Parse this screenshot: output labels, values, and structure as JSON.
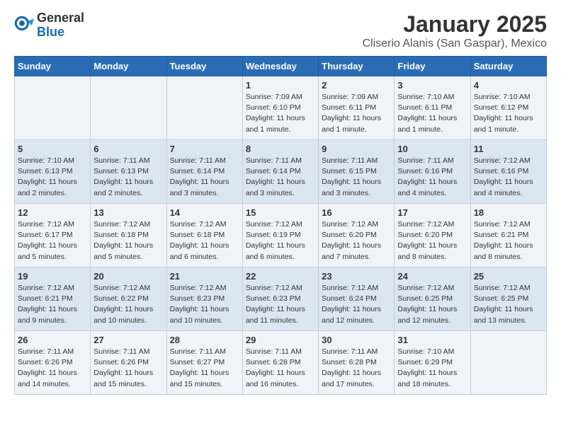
{
  "header": {
    "logo_general": "General",
    "logo_blue": "Blue",
    "title": "January 2025",
    "subtitle": "Cliserio Alanis (San Gaspar), Mexico"
  },
  "days_of_week": [
    "Sunday",
    "Monday",
    "Tuesday",
    "Wednesday",
    "Thursday",
    "Friday",
    "Saturday"
  ],
  "weeks": [
    [
      {
        "day": "",
        "sunrise": "",
        "sunset": "",
        "daylight": ""
      },
      {
        "day": "",
        "sunrise": "",
        "sunset": "",
        "daylight": ""
      },
      {
        "day": "",
        "sunrise": "",
        "sunset": "",
        "daylight": ""
      },
      {
        "day": "1",
        "sunrise": "Sunrise: 7:09 AM",
        "sunset": "Sunset: 6:10 PM",
        "daylight": "Daylight: 11 hours and 1 minute."
      },
      {
        "day": "2",
        "sunrise": "Sunrise: 7:09 AM",
        "sunset": "Sunset: 6:11 PM",
        "daylight": "Daylight: 11 hours and 1 minute."
      },
      {
        "day": "3",
        "sunrise": "Sunrise: 7:10 AM",
        "sunset": "Sunset: 6:11 PM",
        "daylight": "Daylight: 11 hours and 1 minute."
      },
      {
        "day": "4",
        "sunrise": "Sunrise: 7:10 AM",
        "sunset": "Sunset: 6:12 PM",
        "daylight": "Daylight: 11 hours and 1 minute."
      }
    ],
    [
      {
        "day": "5",
        "sunrise": "Sunrise: 7:10 AM",
        "sunset": "Sunset: 6:13 PM",
        "daylight": "Daylight: 11 hours and 2 minutes."
      },
      {
        "day": "6",
        "sunrise": "Sunrise: 7:11 AM",
        "sunset": "Sunset: 6:13 PM",
        "daylight": "Daylight: 11 hours and 2 minutes."
      },
      {
        "day": "7",
        "sunrise": "Sunrise: 7:11 AM",
        "sunset": "Sunset: 6:14 PM",
        "daylight": "Daylight: 11 hours and 3 minutes."
      },
      {
        "day": "8",
        "sunrise": "Sunrise: 7:11 AM",
        "sunset": "Sunset: 6:14 PM",
        "daylight": "Daylight: 11 hours and 3 minutes."
      },
      {
        "day": "9",
        "sunrise": "Sunrise: 7:11 AM",
        "sunset": "Sunset: 6:15 PM",
        "daylight": "Daylight: 11 hours and 3 minutes."
      },
      {
        "day": "10",
        "sunrise": "Sunrise: 7:11 AM",
        "sunset": "Sunset: 6:16 PM",
        "daylight": "Daylight: 11 hours and 4 minutes."
      },
      {
        "day": "11",
        "sunrise": "Sunrise: 7:12 AM",
        "sunset": "Sunset: 6:16 PM",
        "daylight": "Daylight: 11 hours and 4 minutes."
      }
    ],
    [
      {
        "day": "12",
        "sunrise": "Sunrise: 7:12 AM",
        "sunset": "Sunset: 6:17 PM",
        "daylight": "Daylight: 11 hours and 5 minutes."
      },
      {
        "day": "13",
        "sunrise": "Sunrise: 7:12 AM",
        "sunset": "Sunset: 6:18 PM",
        "daylight": "Daylight: 11 hours and 5 minutes."
      },
      {
        "day": "14",
        "sunrise": "Sunrise: 7:12 AM",
        "sunset": "Sunset: 6:18 PM",
        "daylight": "Daylight: 11 hours and 6 minutes."
      },
      {
        "day": "15",
        "sunrise": "Sunrise: 7:12 AM",
        "sunset": "Sunset: 6:19 PM",
        "daylight": "Daylight: 11 hours and 6 minutes."
      },
      {
        "day": "16",
        "sunrise": "Sunrise: 7:12 AM",
        "sunset": "Sunset: 6:20 PM",
        "daylight": "Daylight: 11 hours and 7 minutes."
      },
      {
        "day": "17",
        "sunrise": "Sunrise: 7:12 AM",
        "sunset": "Sunset: 6:20 PM",
        "daylight": "Daylight: 11 hours and 8 minutes."
      },
      {
        "day": "18",
        "sunrise": "Sunrise: 7:12 AM",
        "sunset": "Sunset: 6:21 PM",
        "daylight": "Daylight: 11 hours and 8 minutes."
      }
    ],
    [
      {
        "day": "19",
        "sunrise": "Sunrise: 7:12 AM",
        "sunset": "Sunset: 6:21 PM",
        "daylight": "Daylight: 11 hours and 9 minutes."
      },
      {
        "day": "20",
        "sunrise": "Sunrise: 7:12 AM",
        "sunset": "Sunset: 6:22 PM",
        "daylight": "Daylight: 11 hours and 10 minutes."
      },
      {
        "day": "21",
        "sunrise": "Sunrise: 7:12 AM",
        "sunset": "Sunset: 6:23 PM",
        "daylight": "Daylight: 11 hours and 10 minutes."
      },
      {
        "day": "22",
        "sunrise": "Sunrise: 7:12 AM",
        "sunset": "Sunset: 6:23 PM",
        "daylight": "Daylight: 11 hours and 11 minutes."
      },
      {
        "day": "23",
        "sunrise": "Sunrise: 7:12 AM",
        "sunset": "Sunset: 6:24 PM",
        "daylight": "Daylight: 11 hours and 12 minutes."
      },
      {
        "day": "24",
        "sunrise": "Sunrise: 7:12 AM",
        "sunset": "Sunset: 6:25 PM",
        "daylight": "Daylight: 11 hours and 12 minutes."
      },
      {
        "day": "25",
        "sunrise": "Sunrise: 7:12 AM",
        "sunset": "Sunset: 6:25 PM",
        "daylight": "Daylight: 11 hours and 13 minutes."
      }
    ],
    [
      {
        "day": "26",
        "sunrise": "Sunrise: 7:11 AM",
        "sunset": "Sunset: 6:26 PM",
        "daylight": "Daylight: 11 hours and 14 minutes."
      },
      {
        "day": "27",
        "sunrise": "Sunrise: 7:11 AM",
        "sunset": "Sunset: 6:26 PM",
        "daylight": "Daylight: 11 hours and 15 minutes."
      },
      {
        "day": "28",
        "sunrise": "Sunrise: 7:11 AM",
        "sunset": "Sunset: 6:27 PM",
        "daylight": "Daylight: 11 hours and 15 minutes."
      },
      {
        "day": "29",
        "sunrise": "Sunrise: 7:11 AM",
        "sunset": "Sunset: 6:28 PM",
        "daylight": "Daylight: 11 hours and 16 minutes."
      },
      {
        "day": "30",
        "sunrise": "Sunrise: 7:11 AM",
        "sunset": "Sunset: 6:28 PM",
        "daylight": "Daylight: 11 hours and 17 minutes."
      },
      {
        "day": "31",
        "sunrise": "Sunrise: 7:10 AM",
        "sunset": "Sunset: 6:29 PM",
        "daylight": "Daylight: 11 hours and 18 minutes."
      },
      {
        "day": "",
        "sunrise": "",
        "sunset": "",
        "daylight": ""
      }
    ]
  ]
}
